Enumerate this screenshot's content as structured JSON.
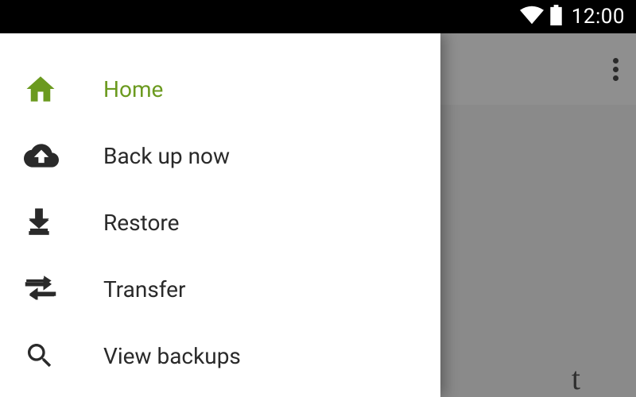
{
  "status": {
    "time": "12:00"
  },
  "drawer": {
    "items": [
      {
        "label": "Home",
        "active": true
      },
      {
        "label": "Back up now",
        "active": false
      },
      {
        "label": "Restore",
        "active": false
      },
      {
        "label": "Transfer",
        "active": false
      },
      {
        "label": "View backups",
        "active": false
      }
    ]
  },
  "colors": {
    "accent": "#6b9a1f"
  },
  "background": {
    "partial_text": "t"
  }
}
